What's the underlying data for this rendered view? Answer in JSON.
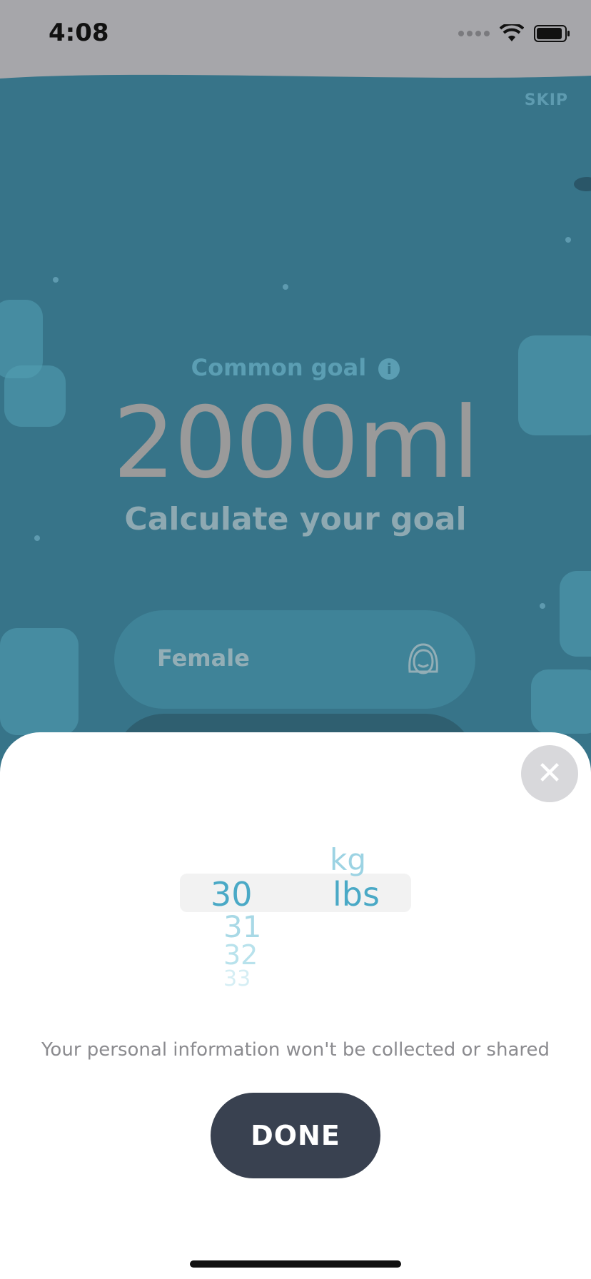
{
  "status_bar": {
    "time": "4:08"
  },
  "header": {
    "skip_label": "SKIP"
  },
  "goal": {
    "common_goal_label": "Common goal",
    "info_symbol": "i",
    "value": "2000ml",
    "calculate_label": "Calculate your goal"
  },
  "gender": {
    "label": "Female"
  },
  "sheet": {
    "close_symbol": "✕",
    "picker": {
      "numbers": [
        "30",
        "31",
        "32",
        "33"
      ],
      "units": [
        "kg",
        "lbs"
      ],
      "selected_number": "30",
      "selected_unit": "lbs"
    },
    "privacy_text": "Your personal information won't be collected or shared",
    "done_label": "DONE"
  },
  "colors": {
    "background": "#377489",
    "sheet": "#ffffff",
    "accent": "#4aa9c6",
    "done_button": "#394150"
  }
}
